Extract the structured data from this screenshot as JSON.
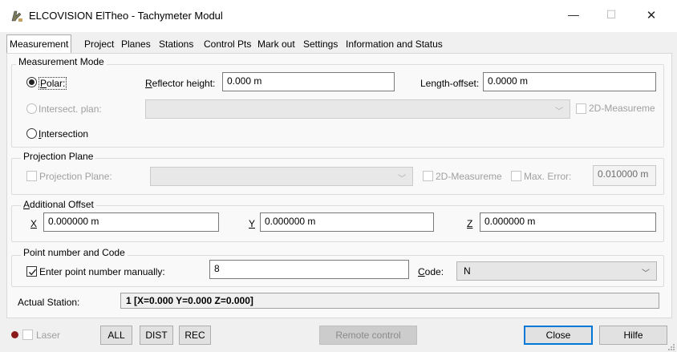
{
  "window": {
    "title": "ELCOVISION ElTheo - Tachymeter Modul",
    "minimize_glyph": "—",
    "maximize_glyph": "☐",
    "close_glyph": "✕"
  },
  "tabs": [
    {
      "label": "Measurement",
      "active": true
    },
    {
      "label": "Project"
    },
    {
      "label": "Planes"
    },
    {
      "label": "Stations"
    },
    {
      "label": "Control Pts"
    },
    {
      "label": "Mark out"
    },
    {
      "label": "Settings"
    },
    {
      "label": "Information and Status"
    }
  ],
  "measurement_mode": {
    "title": "Measurement Mode",
    "polar_label": "Polar:",
    "polar_selected": true,
    "reflector_height_label": "Reflector height:",
    "reflector_height_value": "0.000 m",
    "length_offset_label": "Length-offset:",
    "length_offset_value": "0.0000 m",
    "intersect_plan_label": "Intersect. plan:",
    "intersect_plan_value": "",
    "measure_2d_label": "2D-Measureme",
    "intersection_label": "Intersection"
  },
  "projection_plane": {
    "title": "Projection Plane",
    "projection_plane_label": "Projection Plane:",
    "projection_plane_value": "",
    "measure_2d_label": "2D-Measureme",
    "max_error_label": "Max. Error:",
    "max_error_value": "0.010000 m"
  },
  "additional_offset": {
    "title": "Additional Offset",
    "x_label": "X",
    "x_value": "0.000000 m",
    "y_label": "Y",
    "y_value": "0.000000 m",
    "z_label": "Z",
    "z_value": "0.000000 m"
  },
  "point_number": {
    "title": "Point number and Code",
    "manual_label": "Enter point number manually:",
    "manual_checked": true,
    "point_number_value": "8",
    "code_label": "Code:",
    "code_value": "N"
  },
  "actual_station": {
    "label": "Actual Station:",
    "value": "1  [X=0.000  Y=0.000  Z=0.000]"
  },
  "bottom": {
    "laser_label": "Laser",
    "all_label": "ALL",
    "dist_label": "DIST",
    "rec_label": "REC",
    "remote_label": "Remote control",
    "close_label": "Close",
    "help_label": "Hilfe"
  },
  "colors": {
    "laser_indicator": "#8b1a1a",
    "default_button_border": "#0078d7",
    "dialog_bg": "#f0f0f0"
  }
}
